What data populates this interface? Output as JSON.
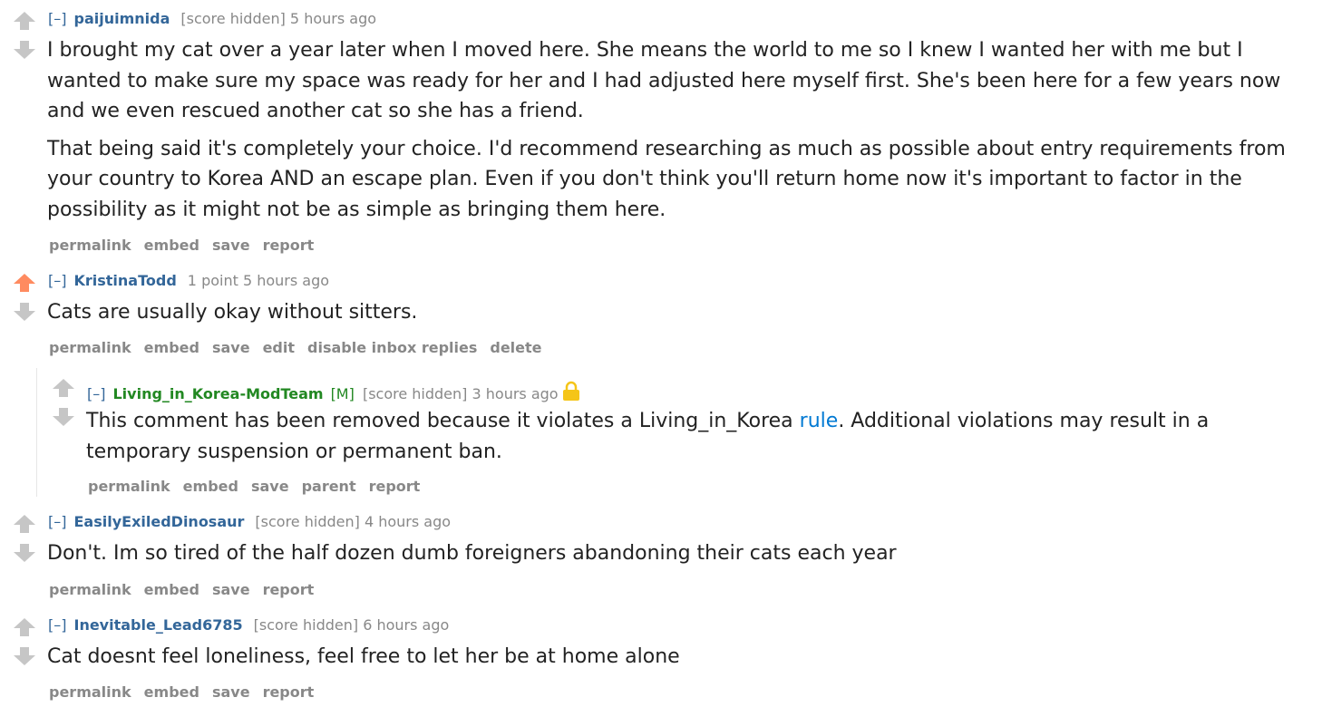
{
  "comments": [
    {
      "expand": "[–]",
      "author": "paijuimnida",
      "score": "[score hidden]",
      "time": "5 hours ago",
      "paragraphs": [
        "I brought my cat over a year later when I moved here. She means the world to me so I knew I wanted her with me but I wanted to make sure my space was ready for her and I had adjusted here myself first. She's been here for a few years now and we even rescued another cat so she has a friend.",
        "That being said it's completely your choice. I'd recommend researching as much as possible about entry requirements from your country to Korea AND an escape plan. Even if you don't think you'll return home now it's important to factor in the possibility as it might not be as simple as bringing them here."
      ],
      "buttons": [
        "permalink",
        "embed",
        "save",
        "report"
      ]
    },
    {
      "expand": "[–]",
      "author": "KristinaTodd",
      "score": "1 point",
      "time": "5 hours ago",
      "paragraphs": [
        "Cats are usually okay without sitters."
      ],
      "buttons": [
        "permalink",
        "embed",
        "save",
        "edit",
        "disable inbox replies",
        "delete"
      ],
      "upvoted": true
    },
    {
      "expand": "[–]",
      "author": "Living_in_Korea-ModTeam",
      "flair": "[M]",
      "score": "[score hidden]",
      "time": "3 hours ago",
      "body_before": "This comment has been removed because it violates a Living_in_Korea ",
      "link": "rule",
      "body_after": ". Additional violations may result in a temporary suspension or permanent ban.",
      "buttons": [
        "permalink",
        "embed",
        "save",
        "parent",
        "report"
      ]
    },
    {
      "expand": "[–]",
      "author": "EasilyExiledDinosaur",
      "score": "[score hidden]",
      "time": "4 hours ago",
      "paragraphs": [
        "Don't. Im so tired of the half dozen dumb foreigners abandoning their cats each year"
      ],
      "buttons": [
        "permalink",
        "embed",
        "save",
        "report"
      ]
    },
    {
      "expand": "[–]",
      "author": "Inevitable_Lead6785",
      "score": "[score hidden]",
      "time": "6 hours ago",
      "paragraphs": [
        "Cat doesnt feel loneliness, feel free to let her be at home alone"
      ],
      "buttons": [
        "permalink",
        "embed",
        "save",
        "report"
      ]
    }
  ],
  "colors": {
    "upvote_active": "#ff8b60",
    "arrow_inactive": "#c6c6c6",
    "author": "#336699",
    "mod": "#228822",
    "link": "#0079d3",
    "lock": "#f5c518"
  },
  "icons": {
    "up": "upvote-arrow-icon",
    "down": "downvote-arrow-icon",
    "lock": "lock-icon"
  }
}
